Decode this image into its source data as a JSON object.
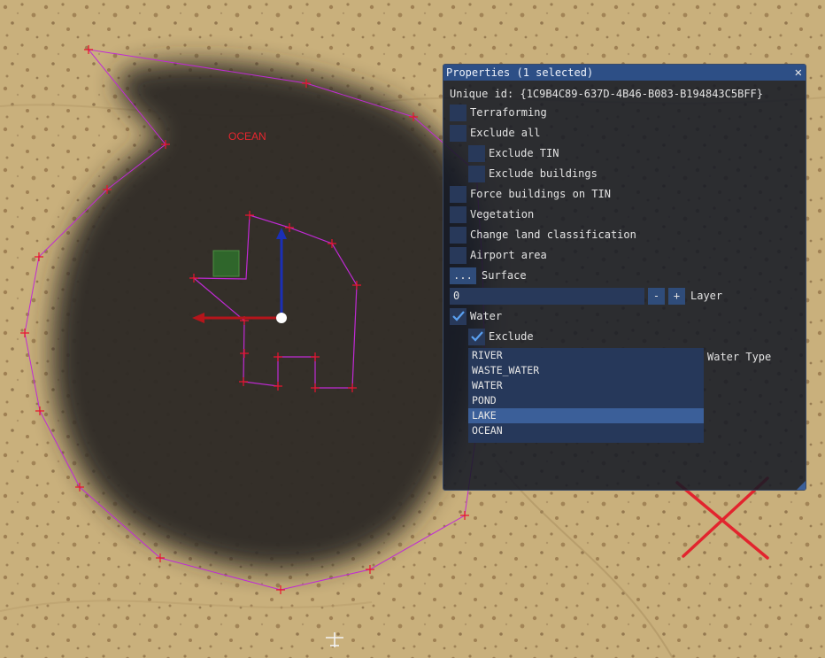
{
  "map": {
    "area_label": "OCEAN",
    "colors": {
      "ground": "#c9b07c",
      "water_shadow": "#2e2b27",
      "outline": "#c02ad4",
      "vertex": "#e8142e",
      "x_mark": "#e2242e"
    }
  },
  "panel": {
    "title": "Properties (1 selected)",
    "close_glyph": "✕",
    "unique_id": "Unique id: {1C9B4C89-637D-4B46-B083-B194843C5BFF}",
    "options": [
      {
        "label": "Terraforming",
        "checked": false
      },
      {
        "label": "Exclude all",
        "checked": false
      },
      {
        "label": "Exclude TIN",
        "checked": false
      },
      {
        "label": "Exclude buildings",
        "checked": false
      },
      {
        "label": "Force buildings on TIN",
        "checked": false
      },
      {
        "label": "Vegetation",
        "checked": false
      },
      {
        "label": "Change land classification",
        "checked": false
      },
      {
        "label": "Airport area",
        "checked": false
      }
    ],
    "surface": {
      "button": "...",
      "label": "Surface"
    },
    "layer": {
      "value": "0",
      "minus": "-",
      "plus": "+",
      "label": "Layer"
    },
    "water": {
      "label": "Water",
      "checked": true
    },
    "exclude": {
      "label": "Exclude",
      "checked": true
    },
    "water_type": {
      "label": "Water Type",
      "items": [
        "RIVER",
        "WASTE_WATER",
        "WATER",
        "POND",
        "LAKE",
        "OCEAN"
      ],
      "selected": "LAKE"
    },
    "accent": "#2d4f86"
  }
}
